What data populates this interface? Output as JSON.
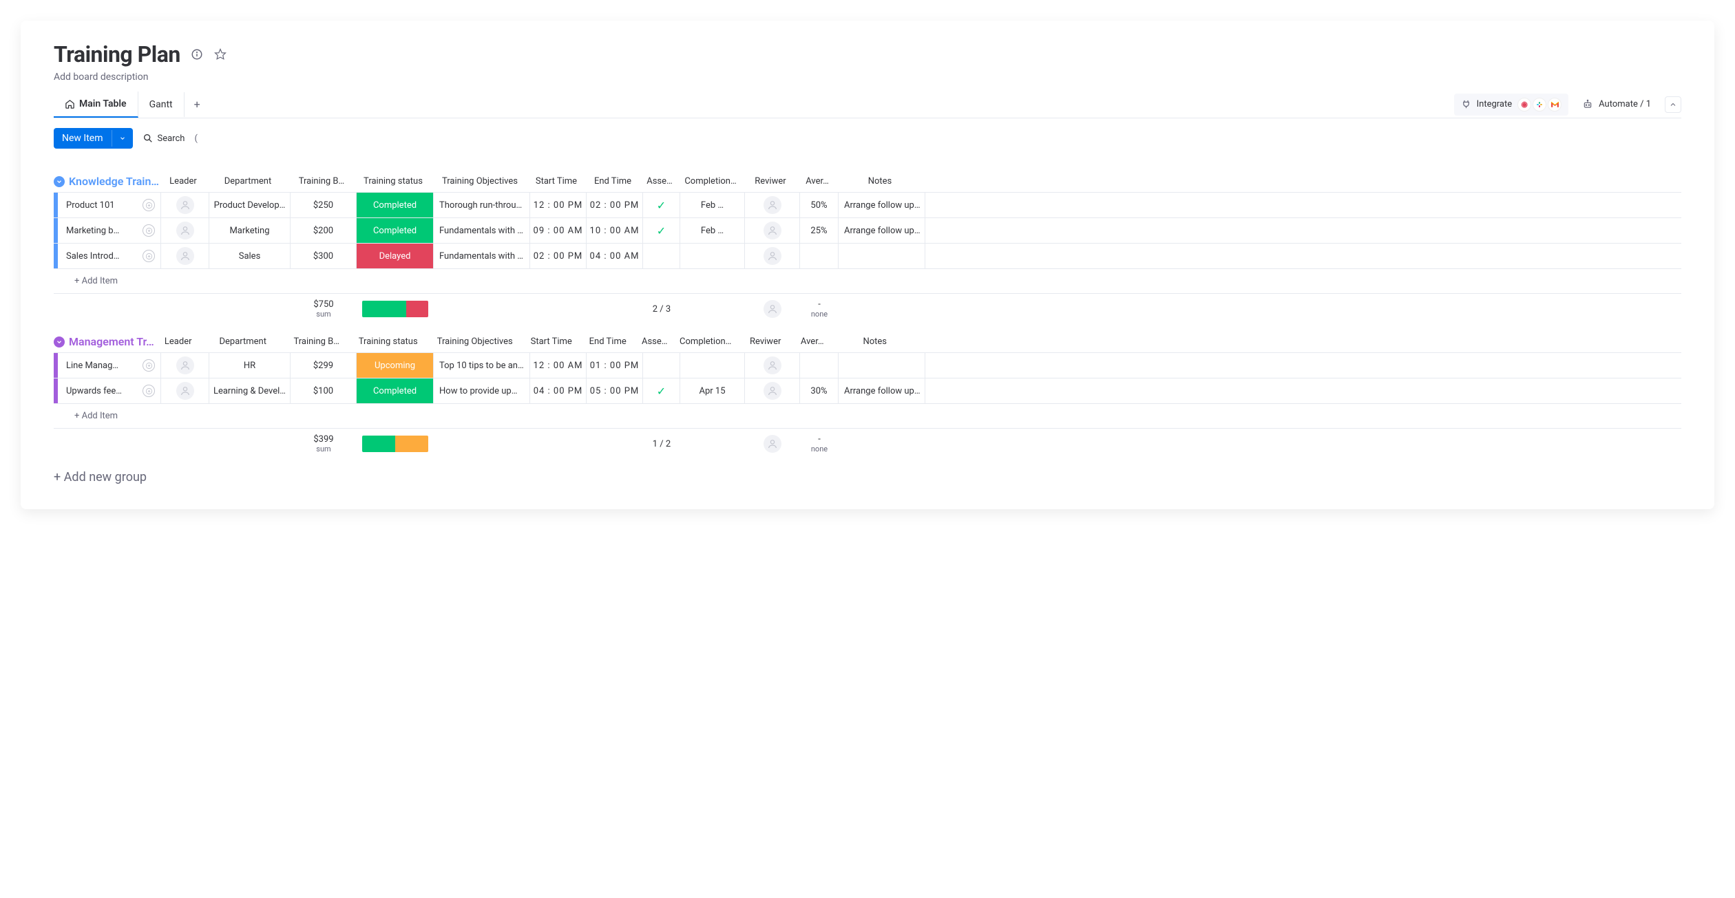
{
  "header": {
    "title": "Training Plan",
    "subtitle": "Add board description"
  },
  "tabs": {
    "main": "Main Table",
    "gantt": "Gantt"
  },
  "topbar": {
    "integrate": "Integrate",
    "automate": "Automate / 1"
  },
  "toolbar": {
    "new_item": "New Item",
    "search": "Search",
    "filter_hint": "("
  },
  "columns": {
    "leader": "Leader",
    "department": "Department",
    "budget": "Training B…",
    "status": "Training status",
    "objectives": "Training Objectives",
    "start": "Start Time",
    "end": "End Time",
    "assess": "Asse…",
    "completion": "Completion…",
    "reviewer": "Reviwer",
    "avg": "Aver…",
    "notes": "Notes"
  },
  "status_colors": {
    "Completed": "#00c875",
    "Delayed": "#e2445c",
    "Upcoming": "#fdab3d"
  },
  "groups": [
    {
      "title": "Knowledge Train…",
      "color": "#579bfc",
      "rows": [
        {
          "name": "Product 101",
          "department": "Product Develop…",
          "budget": "$250",
          "status": "Completed",
          "objectives": "Thorough run-throu…",
          "start": "12 : 00 PM",
          "end": "02 : 00 PM",
          "assess_check": true,
          "completion": "Feb …",
          "avg": "50%",
          "notes": "Arrange follow up…"
        },
        {
          "name": "Marketing b…",
          "department": "Marketing",
          "budget": "$200",
          "status": "Completed",
          "objectives": "Fundamentals with …",
          "start": "09 : 00 AM",
          "end": "10 : 00 AM",
          "assess_check": true,
          "completion": "Feb …",
          "avg": "25%",
          "notes": "Arrange follow up…"
        },
        {
          "name": "Sales Introd…",
          "department": "Sales",
          "budget": "$300",
          "status": "Delayed",
          "objectives": "Fundamentals with …",
          "start": "02 : 00 PM",
          "end": "04 : 00 AM",
          "assess_check": false,
          "completion": "",
          "avg": "",
          "notes": ""
        }
      ],
      "summary": {
        "budget_sum": "$750",
        "budget_label": "sum",
        "status_segments": [
          {
            "color": "#00c875",
            "flex": 2
          },
          {
            "color": "#e2445c",
            "flex": 1
          }
        ],
        "assess": "2 / 3",
        "avg_top": "-",
        "avg_bottom": "none"
      },
      "add_item": "+ Add Item"
    },
    {
      "title": "Management Tr…",
      "color": "#a25ddc",
      "rows": [
        {
          "name": "Line Manag…",
          "department": "HR",
          "budget": "$299",
          "status": "Upcoming",
          "objectives": "Top 10 tips to be an…",
          "start": "12 : 00 AM",
          "end": "01 : 00 PM",
          "assess_check": false,
          "completion": "",
          "avg": "",
          "notes": ""
        },
        {
          "name": "Upwards fee…",
          "department": "Learning & Devel…",
          "budget": "$100",
          "status": "Completed",
          "objectives": "How to provide up…",
          "start": "04 : 00 PM",
          "end": "05 : 00 PM",
          "assess_check": true,
          "completion": "Apr 15",
          "avg": "30%",
          "notes": "Arrange follow up…"
        }
      ],
      "summary": {
        "budget_sum": "$399",
        "budget_label": "sum",
        "status_segments": [
          {
            "color": "#00c875",
            "flex": 1
          },
          {
            "color": "#fdab3d",
            "flex": 1
          }
        ],
        "assess": "1 / 2",
        "avg_top": "-",
        "avg_bottom": "none"
      },
      "add_item": "+ Add Item"
    }
  ],
  "add_group": "+ Add new group"
}
